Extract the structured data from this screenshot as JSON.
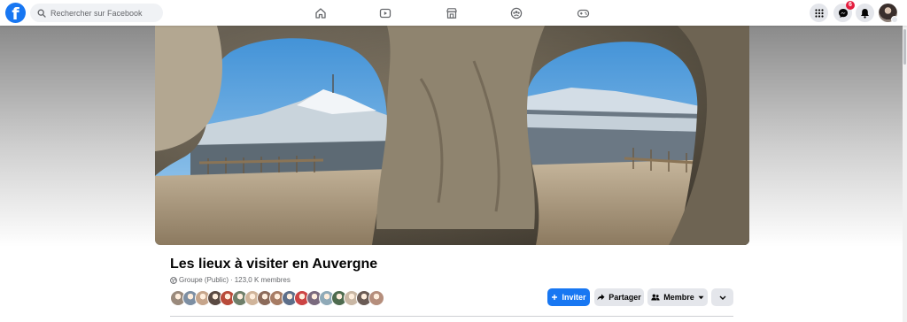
{
  "header": {
    "search_placeholder": "Rechercher sur Facebook",
    "logo_letter": "f",
    "messenger_badge": "6",
    "brand_color": "#1877f2",
    "badge_color": "#e41e3f",
    "nav_icons": [
      "home-icon",
      "watch-icon",
      "marketplace-icon",
      "groups-icon",
      "gaming-icon"
    ],
    "right_icons": [
      "menu-grid-icon",
      "messenger-icon",
      "notifications-icon",
      "account-avatar"
    ]
  },
  "group": {
    "name": "Les lieux à visiter en Auvergne",
    "privacy": "Groupe (Public)",
    "separator": " · ",
    "member_count": "123,0 K membres"
  },
  "actions": {
    "invite": "Inviter",
    "share": "Partager",
    "member": "Membre"
  },
  "member_avatar_colors": [
    "#9a8a7c",
    "#7d8fa3",
    "#c6a58b",
    "#5a4a42",
    "#b94b3a",
    "#6f7f6a",
    "#d0b49a",
    "#8c6b5a",
    "#a77c64",
    "#5d6f8a",
    "#c44",
    "#7a6a7e",
    "#8faab8",
    "#4e6b4f",
    "#c9b7a4",
    "#6a5b55",
    "#b58e7c"
  ]
}
